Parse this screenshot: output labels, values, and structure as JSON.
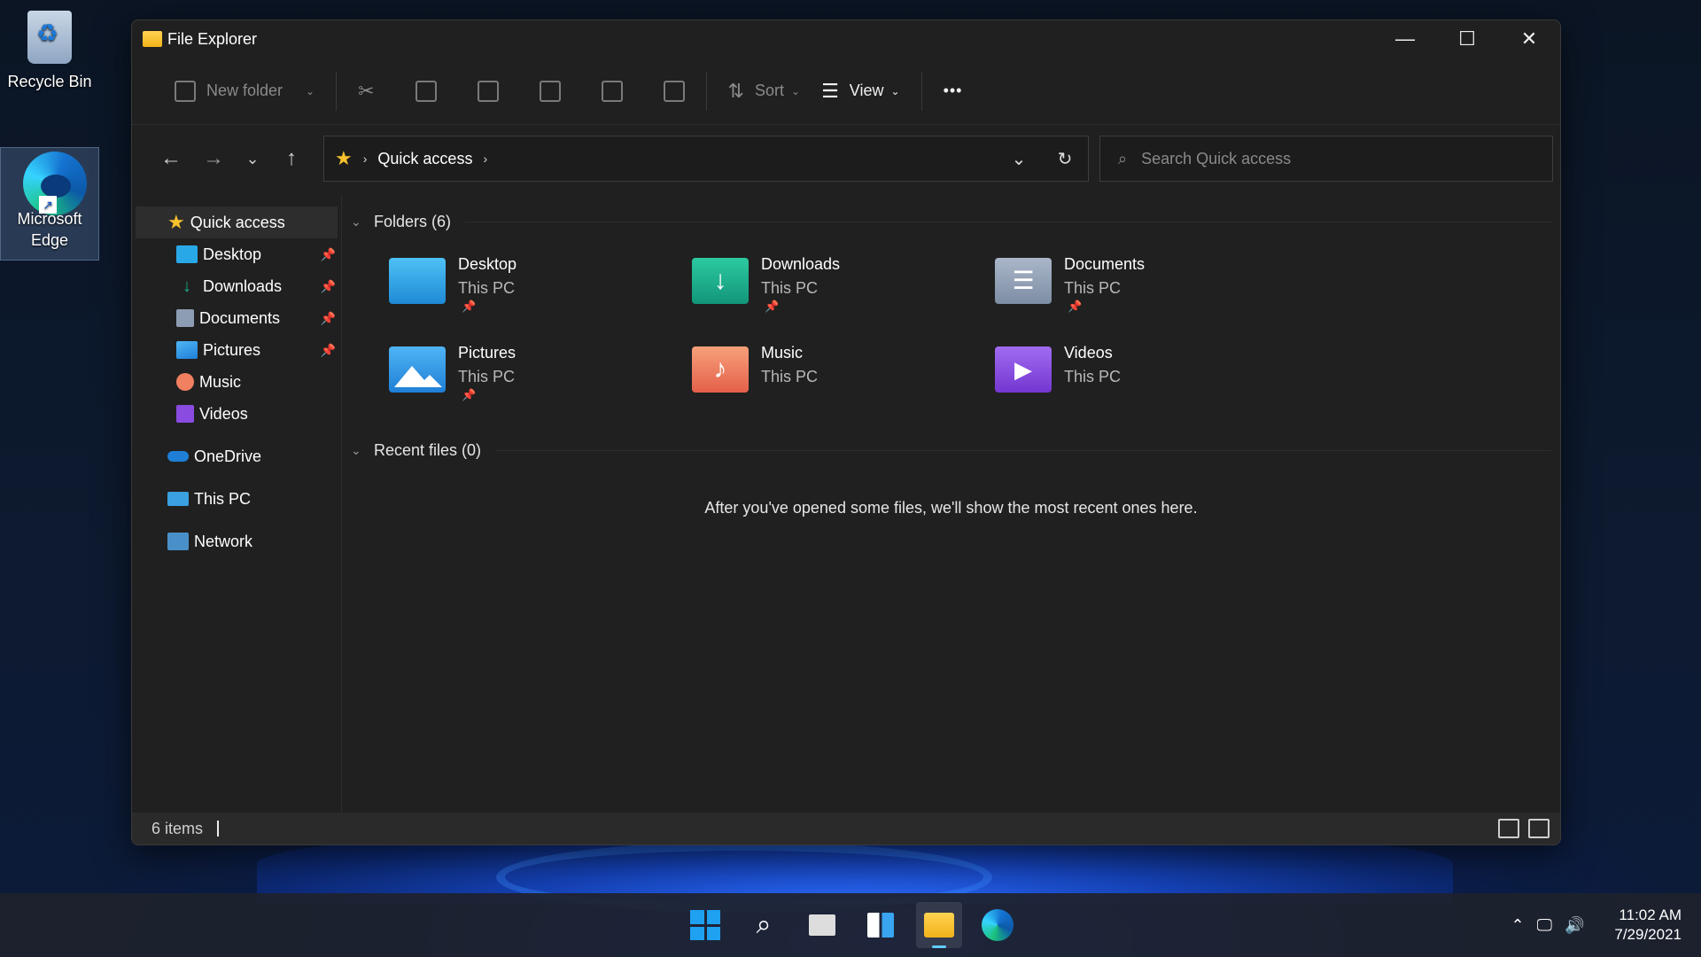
{
  "desktop": {
    "icons": [
      {
        "label": "Recycle Bin"
      },
      {
        "label": "Microsoft Edge"
      }
    ]
  },
  "window": {
    "title": "File Explorer",
    "toolbar": {
      "new_folder": "New folder",
      "sort": "Sort",
      "view": "View",
      "more": "•••"
    },
    "address": {
      "location": "Quick access",
      "search_placeholder": "Search Quick access"
    },
    "sidebar": {
      "quick_access": "Quick access",
      "pinned": [
        {
          "label": "Desktop",
          "pinned": true
        },
        {
          "label": "Downloads",
          "pinned": true
        },
        {
          "label": "Documents",
          "pinned": true
        },
        {
          "label": "Pictures",
          "pinned": true
        },
        {
          "label": "Music",
          "pinned": false
        },
        {
          "label": "Videos",
          "pinned": false
        }
      ],
      "onedrive": "OneDrive",
      "this_pc": "This PC",
      "network": "Network"
    },
    "folders_header": "Folders (6)",
    "folders": [
      {
        "name": "Desktop",
        "location": "This PC",
        "pinned": true,
        "color": "#29a8e8"
      },
      {
        "name": "Downloads",
        "location": "This PC",
        "pinned": true,
        "color": "#1cb08c"
      },
      {
        "name": "Documents",
        "location": "This PC",
        "pinned": true,
        "color": "#8d9db3"
      },
      {
        "name": "Pictures",
        "location": "This PC",
        "pinned": true,
        "color": "#2d9bea"
      },
      {
        "name": "Music",
        "location": "This PC",
        "pinned": false,
        "color": "#f08060"
      },
      {
        "name": "Videos",
        "location": "This PC",
        "pinned": false,
        "color": "#8a4be0"
      }
    ],
    "recent_header": "Recent files (0)",
    "recent_empty": "After you've opened some files, we'll show the most recent ones here.",
    "status": "6 items"
  },
  "taskbar": {
    "time": "11:02 AM",
    "date": "7/29/2021"
  }
}
